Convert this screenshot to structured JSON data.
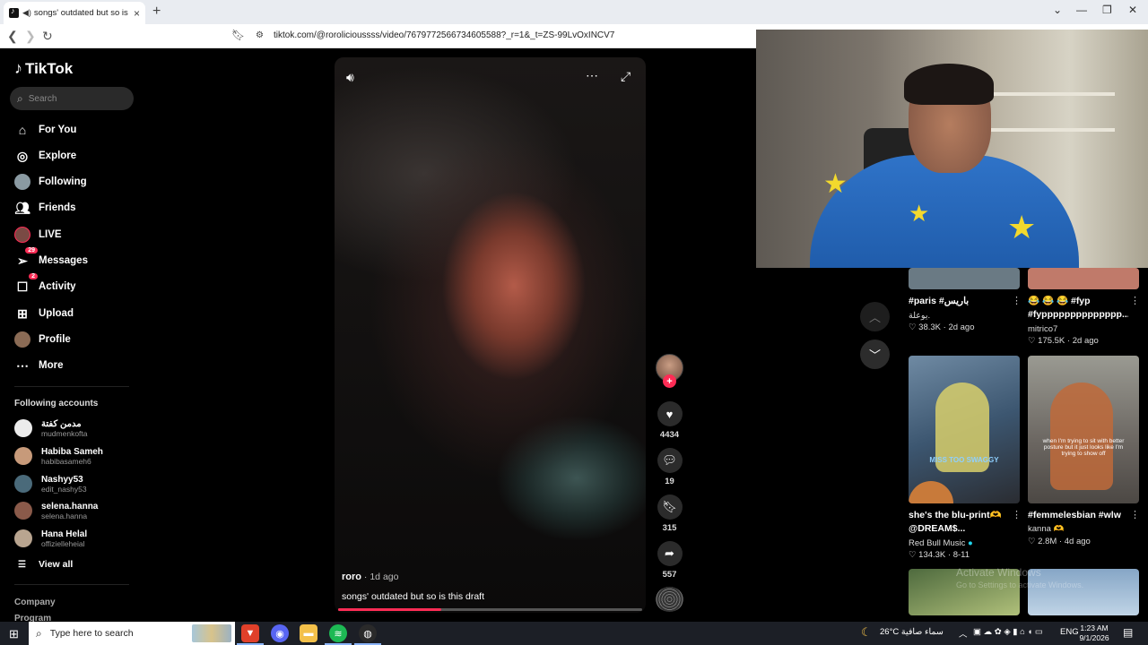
{
  "browser": {
    "tab_title": "songs' outdated but so is this",
    "url": "tiktok.com/@rorolicioussss/video/7679772566734605588?_r=1&_t=ZS-99LvOxINCV7"
  },
  "sidebar": {
    "logo": "TikTok",
    "search_placeholder": "Search",
    "nav": [
      {
        "label": "For You",
        "icon": "home-icon"
      },
      {
        "label": "Explore",
        "icon": "compass-icon"
      },
      {
        "label": "Following",
        "icon": "avatar"
      },
      {
        "label": "Friends",
        "icon": "friends-icon"
      },
      {
        "label": "LIVE",
        "icon": "avatar"
      },
      {
        "label": "Messages",
        "icon": "send-icon",
        "badge": "29"
      },
      {
        "label": "Activity",
        "icon": "inbox-icon",
        "badge": "2"
      },
      {
        "label": "Upload",
        "icon": "plus-square-icon"
      },
      {
        "label": "Profile",
        "icon": "avatar"
      },
      {
        "label": "More",
        "icon": "more-icon"
      }
    ],
    "following_title": "Following accounts",
    "accounts": [
      {
        "name": "مدمن كفتة",
        "handle": "mudmenkofta",
        "color": "#e9e9e9"
      },
      {
        "name": "Habiba Sameh",
        "handle": "habibasameh6",
        "color": "#c79a7a"
      },
      {
        "name": "Nashyy53",
        "handle": "edit_nashy53",
        "color": "#4a6a7a"
      },
      {
        "name": "selena.hanna",
        "handle": "selena.hanna",
        "color": "#8a5a4a"
      },
      {
        "name": "Hana Helal",
        "handle": "offizielleheial",
        "color": "#b9a590"
      }
    ],
    "view_all": "View all",
    "footer": [
      "Company",
      "Program"
    ]
  },
  "video": {
    "author": "roro",
    "ago": "1d ago",
    "caption": "songs' outdated but so is this draft",
    "progress": 0.34
  },
  "actions": {
    "likes": "4434",
    "comments": "19",
    "saves": "315",
    "shares": "557"
  },
  "grid": [
    {
      "title": "#paris #باريس",
      "author": "يوعلة.",
      "views": "38.3K",
      "ago": "2d ago"
    },
    {
      "title": "😂 😂 😂 #fyp #fypppppppppppppp...",
      "author": "mitrico7",
      "views": "175.5K",
      "ago": "2d ago"
    },
    {
      "title": "she's the blu-print🫶 @DREAM$...",
      "author": "Red Bull Music",
      "views": "134.3K",
      "ago": "8-11",
      "overlay": "MISS TOO SWAGGY"
    },
    {
      "title": "#femmelesbian #wlw",
      "author": "kanna 🫶",
      "views": "2.8M",
      "ago": "4d ago",
      "overlay": "when I'm trying to sit with better posture but it just looks like I'm trying to show off"
    }
  ],
  "watermark": {
    "line1": "Activate Windows",
    "line2": "Go to Settings to activate Windows."
  },
  "taskbar": {
    "search_placeholder": "Type here to search",
    "weather": "26°C سماء صافية",
    "lang": "ENG",
    "time": "1:23 AM",
    "date": "9/1/2026"
  }
}
